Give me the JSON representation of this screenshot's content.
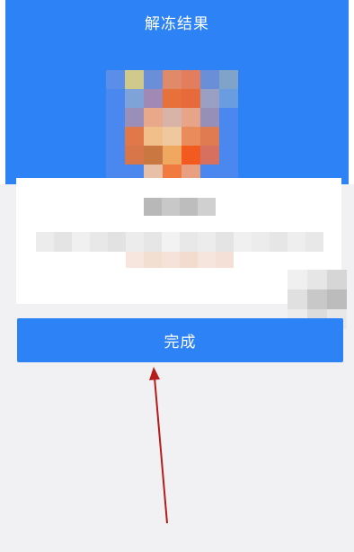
{
  "header": {
    "title": "解冻结果"
  },
  "actions": {
    "done_label": "完成"
  },
  "colors": {
    "primary": "#2d82f5",
    "annotation_arrow": "#b71c1c"
  }
}
